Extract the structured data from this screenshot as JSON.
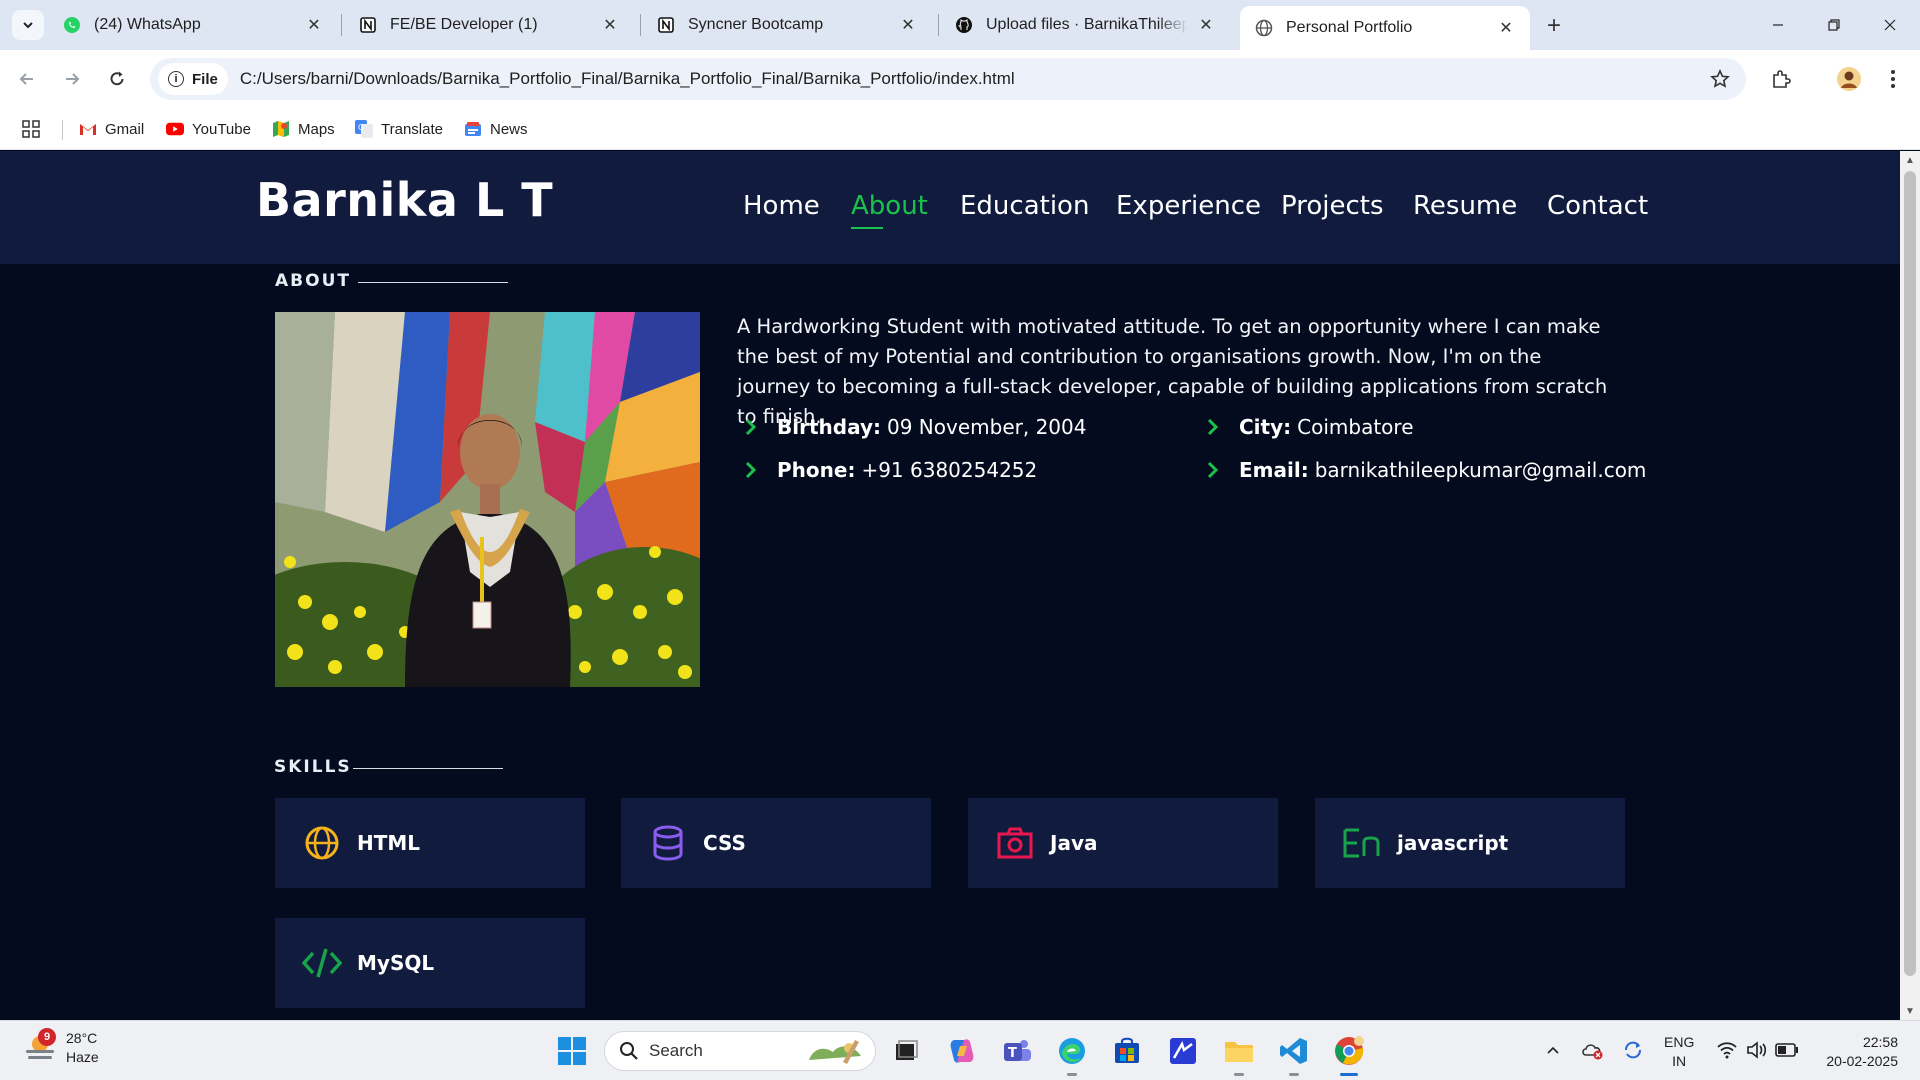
{
  "browser": {
    "tabs": [
      {
        "label": "(24) WhatsApp",
        "icon": "whatsapp-icon"
      },
      {
        "label": "FE/BE Developer (1)",
        "icon": "notion-icon"
      },
      {
        "label": "Syncner Bootcamp",
        "icon": "notion-icon"
      },
      {
        "label": "Upload files · BarnikaThileep/Bo",
        "icon": "github-icon"
      },
      {
        "label": "Personal Portfolio",
        "icon": "globe-icon",
        "active": true
      }
    ],
    "site_chip": "File",
    "url": "C:/Users/barni/Downloads/Barnika_Portfolio_Final/Barnika_Portfolio_Final/Barnika_Portfolio/index.html",
    "bookmarks": [
      {
        "label": "Gmail",
        "icon": "gmail-icon"
      },
      {
        "label": "YouTube",
        "icon": "youtube-icon"
      },
      {
        "label": "Maps",
        "icon": "maps-icon"
      },
      {
        "label": "Translate",
        "icon": "translate-icon"
      },
      {
        "label": "News",
        "icon": "news-icon"
      }
    ]
  },
  "site": {
    "brand": "Barnika L T",
    "nav": [
      "Home",
      "About",
      "Education",
      "Experience",
      "Projects",
      "Resume",
      "Contact"
    ],
    "active_nav": "About",
    "accent_color": "#19c24a",
    "about": {
      "title": "ABOUT",
      "text": "A Hardworking Student with motivated attitude. To get an opportunity where I can make the best of my Potential and contribution to organisations growth. Now, I'm on the journey to becoming a full-stack developer, capable of building applications from scratch to finish.",
      "details": [
        {
          "label": "Birthday:",
          "value": "09 November, 2004"
        },
        {
          "label": "City:",
          "value": "Coimbatore"
        },
        {
          "label": "Phone:",
          "value": "+91 6380254252"
        },
        {
          "label": "Email:",
          "value": "barnikathileepkumar@gmail.com"
        }
      ]
    },
    "skills": {
      "title": "SKILLS",
      "items": [
        {
          "name": "HTML",
          "icon": "globe-icon",
          "color": "#f6b21b"
        },
        {
          "name": "CSS",
          "icon": "database-icon",
          "color": "#8a5cf0"
        },
        {
          "name": "Java",
          "icon": "camera-icon",
          "color": "#e8174e"
        },
        {
          "name": "javascript",
          "icon": "language-icon",
          "color": "#19a34a"
        },
        {
          "name": "MySQL",
          "icon": "code-icon",
          "color": "#19a34a"
        }
      ]
    }
  },
  "taskbar": {
    "weather_temp": "28°C",
    "weather_desc": "Haze",
    "weather_badge": "9",
    "search_label": "Search",
    "lang_line1": "ENG",
    "lang_line2": "IN",
    "time": "22:58",
    "date": "20-02-2025"
  }
}
